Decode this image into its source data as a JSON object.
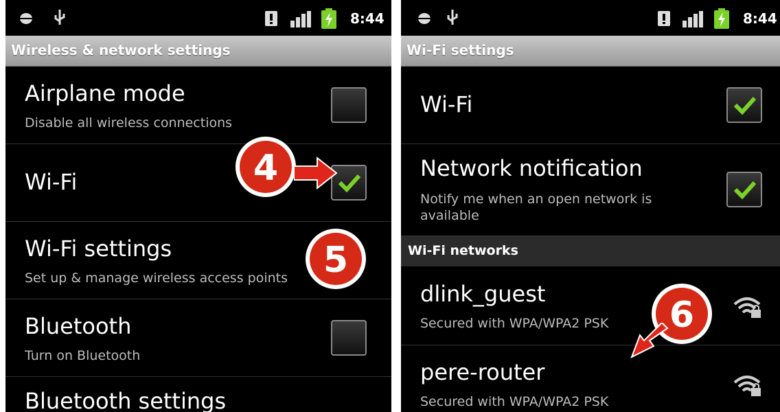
{
  "left_screen": {
    "status_time": "8:44",
    "title": "Wireless & network settings",
    "items": [
      {
        "title": "Airplane mode",
        "subtitle": "Disable all wireless connections",
        "checked": false
      },
      {
        "title": "Wi-Fi",
        "subtitle": "",
        "checked": true
      },
      {
        "title": "Wi-Fi settings",
        "subtitle": "Set up & manage wireless access points"
      },
      {
        "title": "Bluetooth",
        "subtitle": "Turn on Bluetooth",
        "checked": false
      },
      {
        "title": "Bluetooth settings"
      }
    ],
    "annotations": [
      "4",
      "5"
    ]
  },
  "right_screen": {
    "status_time": "8:44",
    "title": "Wi-Fi settings",
    "items": [
      {
        "title": "Wi-Fi",
        "checked": true
      },
      {
        "title": "Network notification",
        "subtitle": "Notify me when an open network is available",
        "checked": true
      }
    ],
    "section_header": "Wi-Fi networks",
    "networks": [
      {
        "name": "dlink_guest",
        "security": "Secured with WPA/WPA2 PSK",
        "icon": "wifi-locked-icon"
      },
      {
        "name": "pere-router",
        "security": "Secured with WPA/WPA2 PSK",
        "icon": "wifi-locked-icon"
      }
    ],
    "annotations": [
      "6"
    ]
  },
  "colors": {
    "badge_red": "#d42a17",
    "check_green": "#7bd12a",
    "arrow_red": "#e0261b"
  }
}
